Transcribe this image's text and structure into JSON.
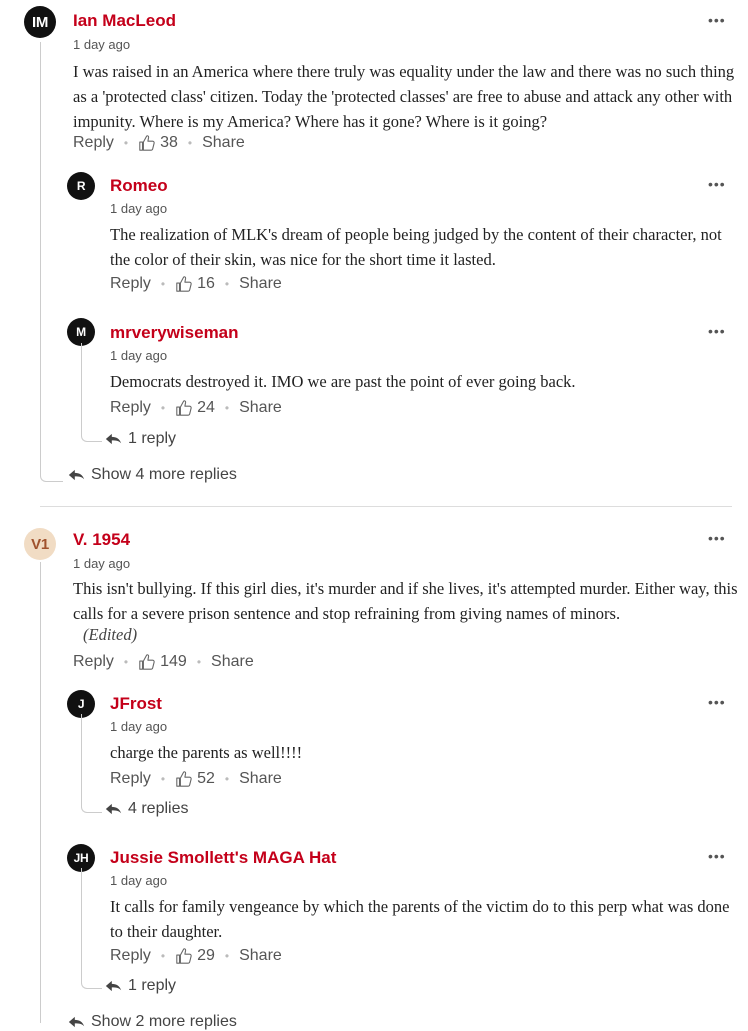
{
  "comments": [
    {
      "avatar": "IM",
      "author": "Ian MacLeod",
      "time": "1 day ago",
      "text": "I was raised in an America where there truly was equality under the law and there was no such thing as a 'protected class' citizen.  Today the 'protected classes' are free to abuse and attack any other with impunity.  Where is my America?  Where has it gone?  Where is it going?",
      "reply_label": "Reply",
      "likes": "38",
      "share_label": "Share",
      "replies": [
        {
          "avatar": "R",
          "author": "Romeo",
          "time": "1 day ago",
          "text": "The realization of MLK's dream of people being judged by the content of their character, not the color of their skin, was nice for the short time it lasted.",
          "reply_label": "Reply",
          "likes": "16",
          "share_label": "Share"
        },
        {
          "avatar": "M",
          "author": "mrverywiseman",
          "time": "1 day ago",
          "text": "Democrats destroyed it. IMO we are past the point of ever going back.",
          "reply_label": "Reply",
          "likes": "24",
          "share_label": "Share",
          "replies_link": "1 reply"
        }
      ],
      "more_replies": "Show 4 more replies"
    },
    {
      "avatar": "V1",
      "author": "V. 1954",
      "time": "1 day ago",
      "text": "This isn't bullying. If this girl dies, it's murder and if she lives, it's attempted murder. Either way, this calls for a severe prison sentence and stop refraining from giving names of minors.",
      "edited": "(Edited)",
      "reply_label": "Reply",
      "likes": "149",
      "share_label": "Share",
      "replies": [
        {
          "avatar": "J",
          "author": "JFrost",
          "time": "1 day ago",
          "text": "charge the parents as well!!!!",
          "reply_label": "Reply",
          "likes": "52",
          "share_label": "Share",
          "replies_link": "4 replies"
        },
        {
          "avatar": "JH",
          "author": "Jussie Smollett's MAGA Hat",
          "time": "1 day ago",
          "text": "It calls for family vengeance by which the parents of the victim do to this perp what was done to their daughter.",
          "reply_label": "Reply",
          "likes": "29",
          "share_label": "Share",
          "replies_link": "1 reply"
        }
      ],
      "more_replies": "Show 2 more replies"
    }
  ],
  "menu_glyph": "•••",
  "icons": {
    "like": "thumbs-up-icon",
    "reply": "reply-arrow-icon",
    "menu": "more-options-icon"
  },
  "colors": {
    "author": "#c4001a",
    "divider": "#dddddd",
    "muted": "#555555"
  }
}
